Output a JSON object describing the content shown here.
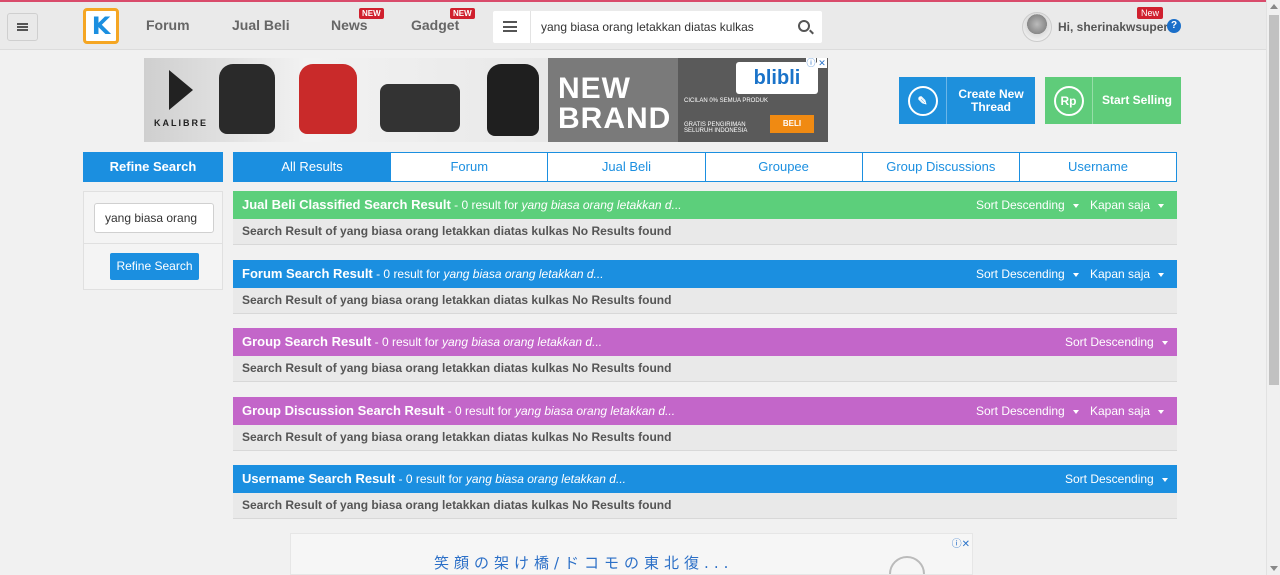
{
  "header": {
    "nav": [
      {
        "label": "Forum",
        "badge": ""
      },
      {
        "label": "Jual Beli",
        "badge": ""
      },
      {
        "label": "News",
        "badge": "NEW"
      },
      {
        "label": "Gadget",
        "badge": "NEW"
      }
    ],
    "search_value": "yang biasa orang letakkan diatas kulkas",
    "user": {
      "greeting": "Hi, sherinakwsuper",
      "badge": "New"
    },
    "help_glyph": "?",
    "logo_glyph": "K"
  },
  "banner_ad": {
    "brand": "KALIBRE",
    "headline_line1": "NEW",
    "headline_line2": "BRAND",
    "store": "blibli",
    "line1": "CICILAN 0% SEMUA PRODUK",
    "line2": "GRATIS PENGIRIMAN SELURUH INDONESIA",
    "cta": "BELI",
    "close": "✕",
    "info": "ⓘ"
  },
  "actions": {
    "create_thread_line1": "Create New",
    "create_thread_line2": "Thread",
    "start_selling": "Start Selling",
    "sell_icon_text": "Rp",
    "thread_icon_text": "✎"
  },
  "refine": {
    "title": "Refine Search",
    "input_value": "yang biasa orang",
    "button": "Refine Search"
  },
  "tabs": [
    "All Results",
    "Forum",
    "Jual Beli",
    "Groupee",
    "Group Discussions",
    "Username"
  ],
  "results": [
    {
      "title": "Jual Beli Classified Search Result",
      "count": " - 0 result for ",
      "query": "yang biasa orang letakkan d...",
      "sort": "Sort Descending",
      "time": "Kapan saja",
      "body": "Search Result of yang biasa orang letakkan diatas kulkas No Results found",
      "color": "#5ccf7b"
    },
    {
      "title": "Forum Search Result",
      "count": " - 0 result for ",
      "query": "yang biasa orang letakkan d...",
      "sort": "Sort Descending",
      "time": "Kapan saja",
      "body": "Search Result of yang biasa orang letakkan diatas kulkas No Results found",
      "color": "#1b8fe0"
    },
    {
      "title": "Group Search Result",
      "count": " - 0 result for ",
      "query": "yang biasa orang letakkan d...",
      "sort": "Sort Descending",
      "time": "",
      "body": "Search Result of yang biasa orang letakkan diatas kulkas No Results found",
      "color": "#c366c9"
    },
    {
      "title": "Group Discussion Search Result",
      "count": " - 0 result for ",
      "query": "yang biasa orang letakkan d...",
      "sort": "Sort Descending",
      "time": "Kapan saja",
      "body": "Search Result of yang biasa orang letakkan diatas kulkas No Results found",
      "color": "#c366c9"
    },
    {
      "title": "Username Search Result",
      "count": " - 0 result for ",
      "query": "yang biasa orang letakkan d...",
      "sort": "Sort Descending",
      "time": "",
      "body": "Search Result of yang biasa orang letakkan diatas kulkas No Results found",
      "color": "#1b8fe0"
    }
  ],
  "bottom_ad": {
    "text": "笑顔の架け橋/ドコモの東北復...",
    "close": "ⓘ✕"
  },
  "colors": {
    "accent": "#1b8fe0",
    "green": "#5ccf7b",
    "purple": "#c366c9",
    "badge_red": "#d0202e"
  }
}
